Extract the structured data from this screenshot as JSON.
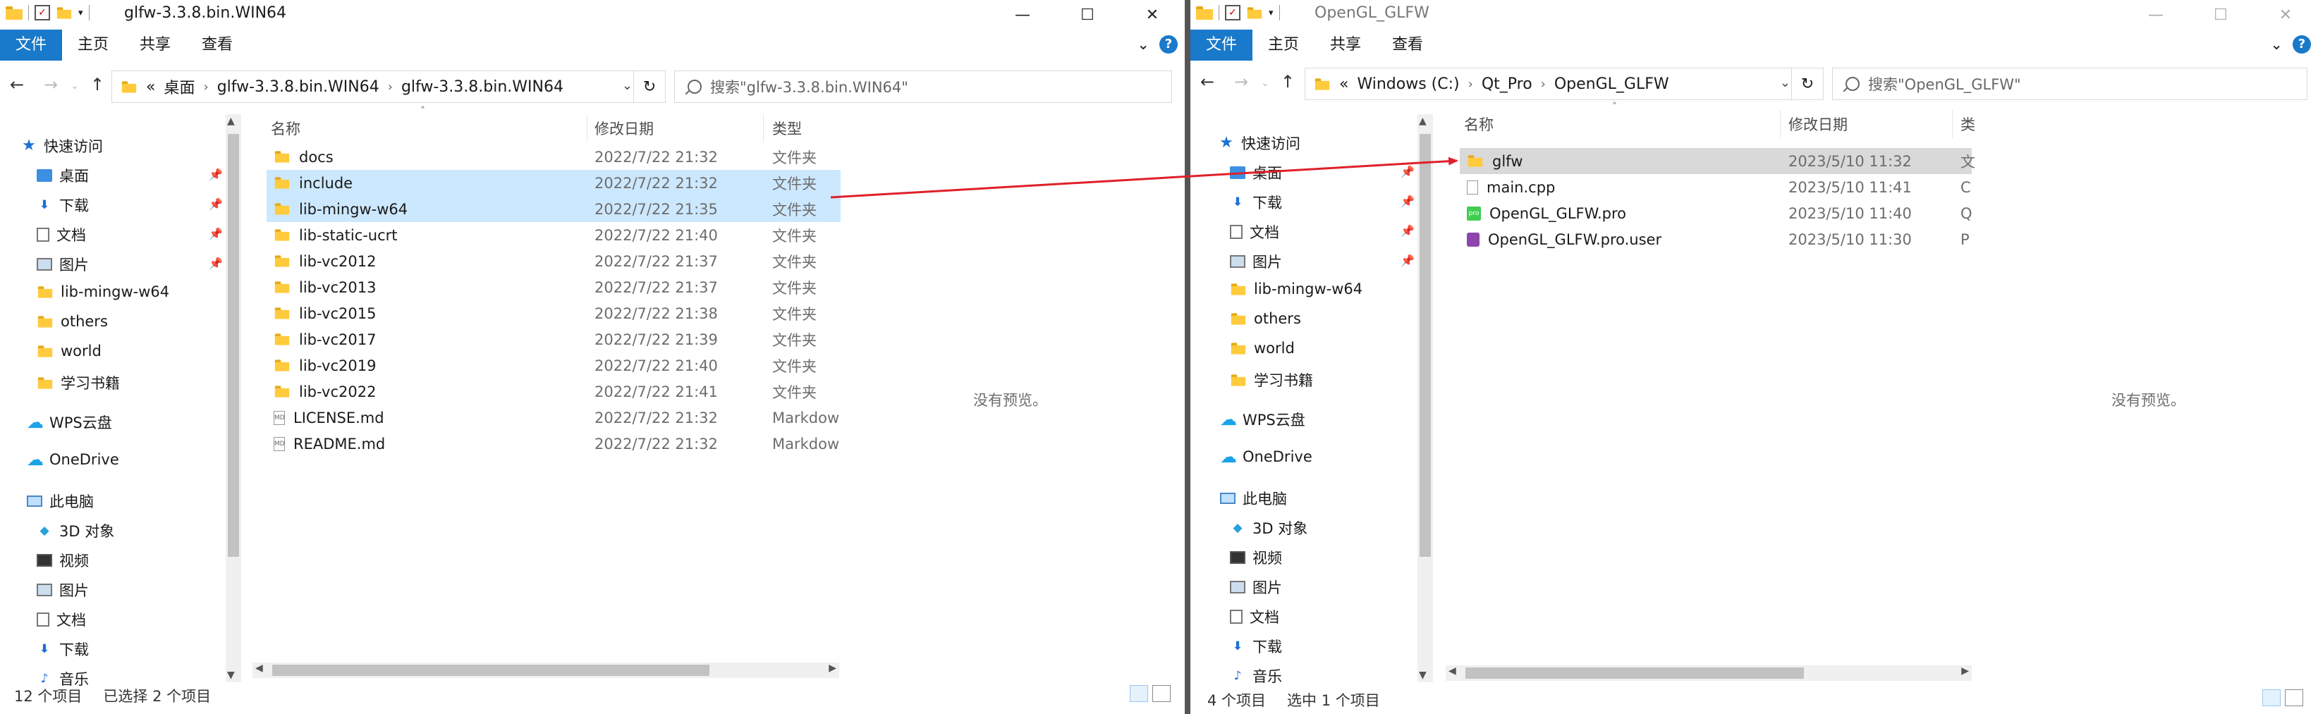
{
  "left": {
    "title": "glfw-3.3.8.bin.WIN64",
    "ribbon": [
      "文件",
      "主页",
      "共享",
      "查看"
    ],
    "help_glyph": "?",
    "breadcrumbs": [
      "«",
      "桌面",
      "glfw-3.3.8.bin.WIN64",
      "glfw-3.3.8.bin.WIN64"
    ],
    "search_placeholder": "搜索\"glfw-3.3.8.bin.WIN64\"",
    "nav": {
      "quick_access": "快速访问",
      "desktop": "桌面",
      "downloads": "下载",
      "documents": "文档",
      "pictures": "图片",
      "lib_mingw": "lib-mingw-w64",
      "others": "others",
      "world": "world",
      "books": "学习书籍",
      "wps": "WPS云盘",
      "onedrive": "OneDrive",
      "this_pc": "此电脑",
      "objects3d": "3D 对象",
      "videos": "视频",
      "pictures2": "图片",
      "documents2": "文档",
      "downloads2": "下载",
      "music": "音乐"
    },
    "columns": {
      "name": "名称",
      "date": "修改日期",
      "type": "类型"
    },
    "files": [
      {
        "name": "docs",
        "date": "2022/7/22 21:32",
        "type": "文件夹"
      },
      {
        "name": "include",
        "date": "2022/7/22 21:32",
        "type": "文件夹"
      },
      {
        "name": "lib-mingw-w64",
        "date": "2022/7/22 21:35",
        "type": "文件夹"
      },
      {
        "name": "lib-static-ucrt",
        "date": "2022/7/22 21:40",
        "type": "文件夹"
      },
      {
        "name": "lib-vc2012",
        "date": "2022/7/22 21:37",
        "type": "文件夹"
      },
      {
        "name": "lib-vc2013",
        "date": "2022/7/22 21:37",
        "type": "文件夹"
      },
      {
        "name": "lib-vc2015",
        "date": "2022/7/22 21:38",
        "type": "文件夹"
      },
      {
        "name": "lib-vc2017",
        "date": "2022/7/22 21:39",
        "type": "文件夹"
      },
      {
        "name": "lib-vc2019",
        "date": "2022/7/22 21:40",
        "type": "文件夹"
      },
      {
        "name": "lib-vc2022",
        "date": "2022/7/22 21:41",
        "type": "文件夹"
      },
      {
        "name": "LICENSE.md",
        "date": "2022/7/22 21:32",
        "type": "Markdow"
      },
      {
        "name": "README.md",
        "date": "2022/7/22 21:32",
        "type": "Markdow"
      }
    ],
    "preview": "没有预览。",
    "status": {
      "count": "12 个项目",
      "selected": "已选择 2 个项目"
    }
  },
  "right": {
    "title": "OpenGL_GLFW",
    "ribbon": [
      "文件",
      "主页",
      "共享",
      "查看"
    ],
    "help_glyph": "?",
    "breadcrumbs": [
      "«",
      "Windows (C:)",
      "Qt_Pro",
      "OpenGL_GLFW"
    ],
    "search_placeholder": "搜索\"OpenGL_GLFW\"",
    "nav": {
      "quick_access": "快速访问",
      "desktop": "桌面",
      "downloads": "下载",
      "documents": "文档",
      "pictures": "图片",
      "lib_mingw": "lib-mingw-w64",
      "others": "others",
      "world": "world",
      "books": "学习书籍",
      "wps": "WPS云盘",
      "onedrive": "OneDrive",
      "this_pc": "此电脑",
      "objects3d": "3D 对象",
      "videos": "视频",
      "pictures2": "图片",
      "documents2": "文档",
      "downloads2": "下载",
      "music": "音乐"
    },
    "columns": {
      "name": "名称",
      "date": "修改日期",
      "type": "类"
    },
    "files": [
      {
        "name": "glfw",
        "date": "2023/5/10 11:32",
        "type": "文"
      },
      {
        "name": "main.cpp",
        "date": "2023/5/10 11:41",
        "type": "C"
      },
      {
        "name": "OpenGL_GLFW.pro",
        "date": "2023/5/10 11:40",
        "type": "Q"
      },
      {
        "name": "OpenGL_GLFW.pro.user",
        "date": "2023/5/10 11:30",
        "type": "P"
      }
    ],
    "pro_icon_label": "pro",
    "preview": "没有预览。",
    "status": {
      "count": "4 个项目",
      "selected": "选中 1 个项目"
    }
  },
  "icons": {
    "back": "←",
    "forward": "→",
    "up": "↑",
    "refresh": "↻",
    "minimize": "—",
    "maximize": "☐",
    "close": "✕",
    "chevron": "›",
    "dropdown": "⌄",
    "expand": "›"
  },
  "colors": {
    "accent": "#1979ca",
    "selection": "#cce8ff",
    "arrow": "#e0202a"
  }
}
